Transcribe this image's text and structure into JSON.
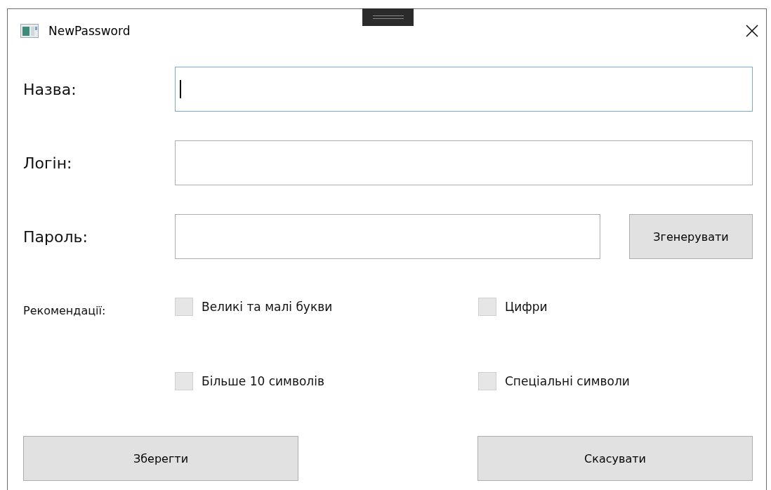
{
  "window": {
    "title": "NewPassword"
  },
  "fields": [
    {
      "label": "Назва:",
      "focused": true
    },
    {
      "label": "Логін:",
      "focused": false
    },
    {
      "label": "Пароль:",
      "focused": false,
      "button": "Згенерувати"
    }
  ],
  "recommendations": {
    "label": "Рекомендації:",
    "items": [
      {
        "label": "Великі та малі букви",
        "checked": false
      },
      {
        "label": "Цифри",
        "checked": false
      },
      {
        "label": "Більше 10 символів",
        "checked": false
      },
      {
        "label": "Спеціальні символи",
        "checked": false
      }
    ]
  },
  "buttons": [
    "Зберегти",
    "Скасувати"
  ]
}
